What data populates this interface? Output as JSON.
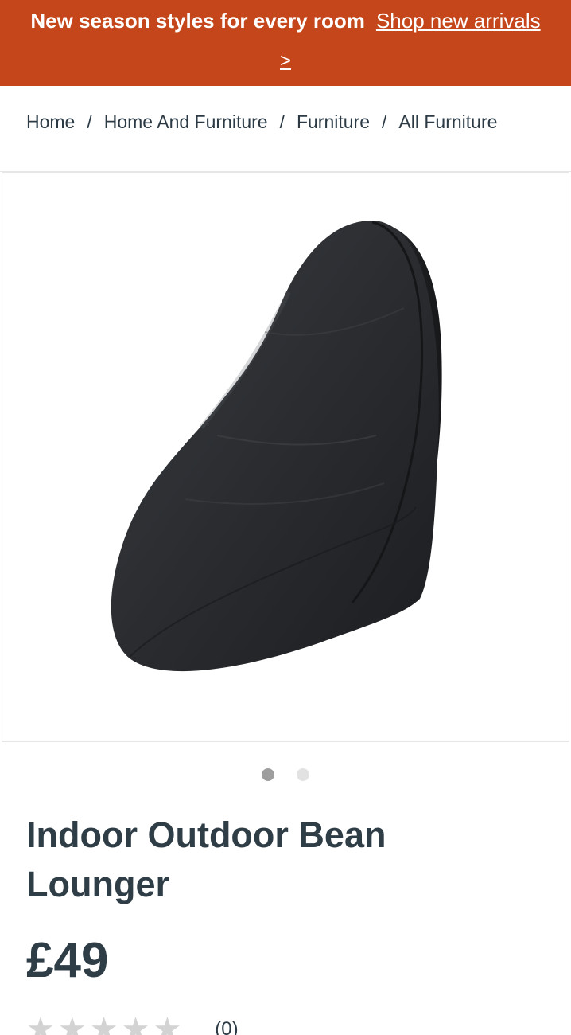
{
  "promo": {
    "text": "New season styles for every room",
    "link_label": "Shop new arrivals",
    "link_arrow": ">"
  },
  "breadcrumb": {
    "items": [
      "Home",
      "Home And Furniture",
      "Furniture",
      "All Furniture"
    ],
    "separator": "/"
  },
  "gallery": {
    "image_alt": "Indoor Outdoor Bean Lounger",
    "slide_count": 2,
    "active_slide": 1
  },
  "product": {
    "title": "Indoor Outdoor Bean Lounger",
    "price": "£49",
    "rating_stars": 0,
    "rating_max": 5,
    "review_count": "(0)"
  },
  "colors": {
    "promo_bg": "#c4461a",
    "text": "#2f3d47",
    "star_empty": "#d3d3d3"
  }
}
